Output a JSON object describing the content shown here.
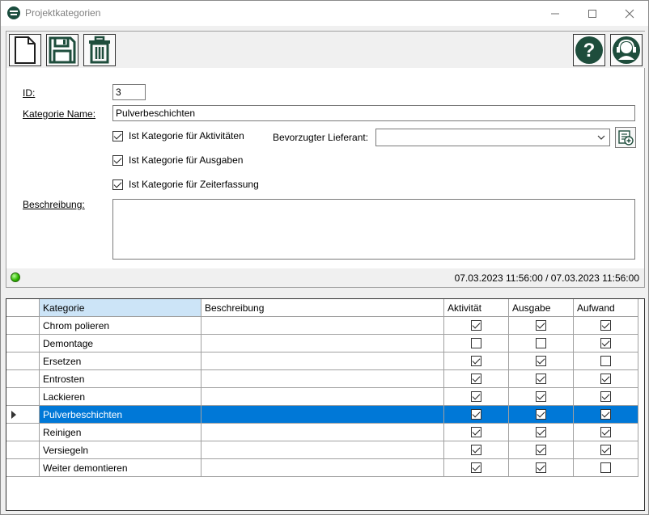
{
  "window": {
    "title": "Projektkategorien"
  },
  "toolbar": {
    "new": "new-document-icon",
    "save": "save-icon",
    "delete": "trash-icon",
    "help": "help-icon",
    "support": "support-headset-icon"
  },
  "form": {
    "id_label": "ID:",
    "id_value": "3",
    "name_label": "Kategorie Name:",
    "name_value": "Pulverbeschichten",
    "cb_activities": "Ist Kategorie für Aktivitäten",
    "cb_expenses": "Ist Kategorie für Ausgaben",
    "cb_timetracking": "Ist Kategorie für Zeiterfassung",
    "supplier_label": "Bevorzugter Lieferant:",
    "supplier_value": "",
    "description_label": "Beschreibung:",
    "description_value": ""
  },
  "status": {
    "timestamp": "07.03.2023 11:56:00 / 07.03.2023 11:56:00",
    "led_color": "#2fb800"
  },
  "grid": {
    "headers": {
      "category": "Kategorie",
      "description": "Beschreibung",
      "activity": "Aktivität",
      "expense": "Ausgabe",
      "effort": "Aufwand"
    },
    "selected_color": "#0078d7",
    "rows": [
      {
        "category": "Chrom polieren",
        "description": "",
        "activity": true,
        "expense": true,
        "effort": true
      },
      {
        "category": "Demontage",
        "description": "",
        "activity": false,
        "expense": false,
        "effort": true
      },
      {
        "category": "Ersetzen",
        "description": "",
        "activity": true,
        "expense": true,
        "effort": false
      },
      {
        "category": "Entrosten",
        "description": "",
        "activity": true,
        "expense": true,
        "effort": true
      },
      {
        "category": "Lackieren",
        "description": "",
        "activity": true,
        "expense": true,
        "effort": true
      },
      {
        "category": "Pulverbeschichten",
        "description": "",
        "activity": true,
        "expense": true,
        "effort": true,
        "selected": true
      },
      {
        "category": "Reinigen",
        "description": "",
        "activity": true,
        "expense": true,
        "effort": true
      },
      {
        "category": "Versiegeln",
        "description": "",
        "activity": true,
        "expense": true,
        "effort": true
      },
      {
        "category": "Weiter demontieren",
        "description": "",
        "activity": true,
        "expense": true,
        "effort": false
      }
    ]
  }
}
